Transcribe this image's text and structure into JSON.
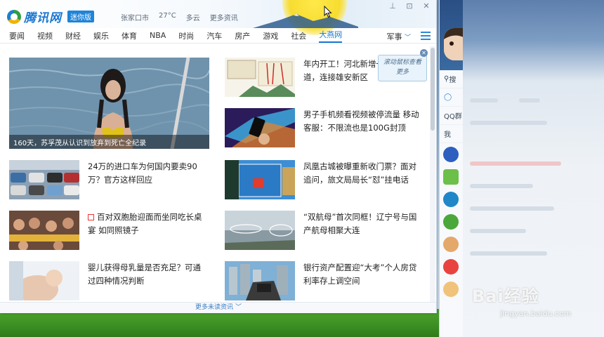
{
  "app": {
    "logo_text": "腾讯网",
    "logo_badge": "迷你版",
    "weather": {
      "city": "张家口市",
      "temp": "27°C",
      "condition": "多云",
      "more": "更多资讯"
    }
  },
  "nav": {
    "items": [
      "要闻",
      "视频",
      "财经",
      "娱乐",
      "体育",
      "NBA",
      "时尚",
      "汽车",
      "房产",
      "游戏",
      "社会",
      "大燕网"
    ],
    "active_index": 11,
    "more_label": "军事"
  },
  "hero": {
    "caption": "160天，苏孚茂从认识到放弃到死亡全纪录"
  },
  "news_right": [
    {
      "title": "年内开工！河北新增一条大通道，连接雄安新区"
    },
    {
      "title": "男子手机频看视频被停流量 移动客服：不限流也是100G封顶"
    },
    {
      "title": "凤凰古城被曝重新收门票？面对追问，旅文局局长“怼”挂电话"
    },
    {
      "title": "“双航母”首次同框！辽宁号与国产航母相聚大连"
    },
    {
      "title": "银行资产配置迎“大考”个人房贷利率存上调空间"
    }
  ],
  "news_left": [
    {
      "title": "24万的进口车为何国内要卖90万？官方这样回应",
      "tag": false
    },
    {
      "title": "百对双胞胎迎面而坐同吃长桌宴 如同照镜子",
      "tag": true
    },
    {
      "title": "婴儿获得母乳量是否充足？可通过四种情况判断",
      "tag": false
    }
  ],
  "tooltip": {
    "text": "滚动鼠标查看更多"
  },
  "footer": {
    "more_label": "更多未读资讯"
  },
  "qq": {
    "search_label": "搜",
    "group_label": "QQ群",
    "my_label": "我"
  },
  "watermark": {
    "brand": "Bai经验",
    "url": "jingyan.baidu.com"
  },
  "colors": {
    "accent": "#1a78d2",
    "desktop_green": "#3b8f23"
  }
}
